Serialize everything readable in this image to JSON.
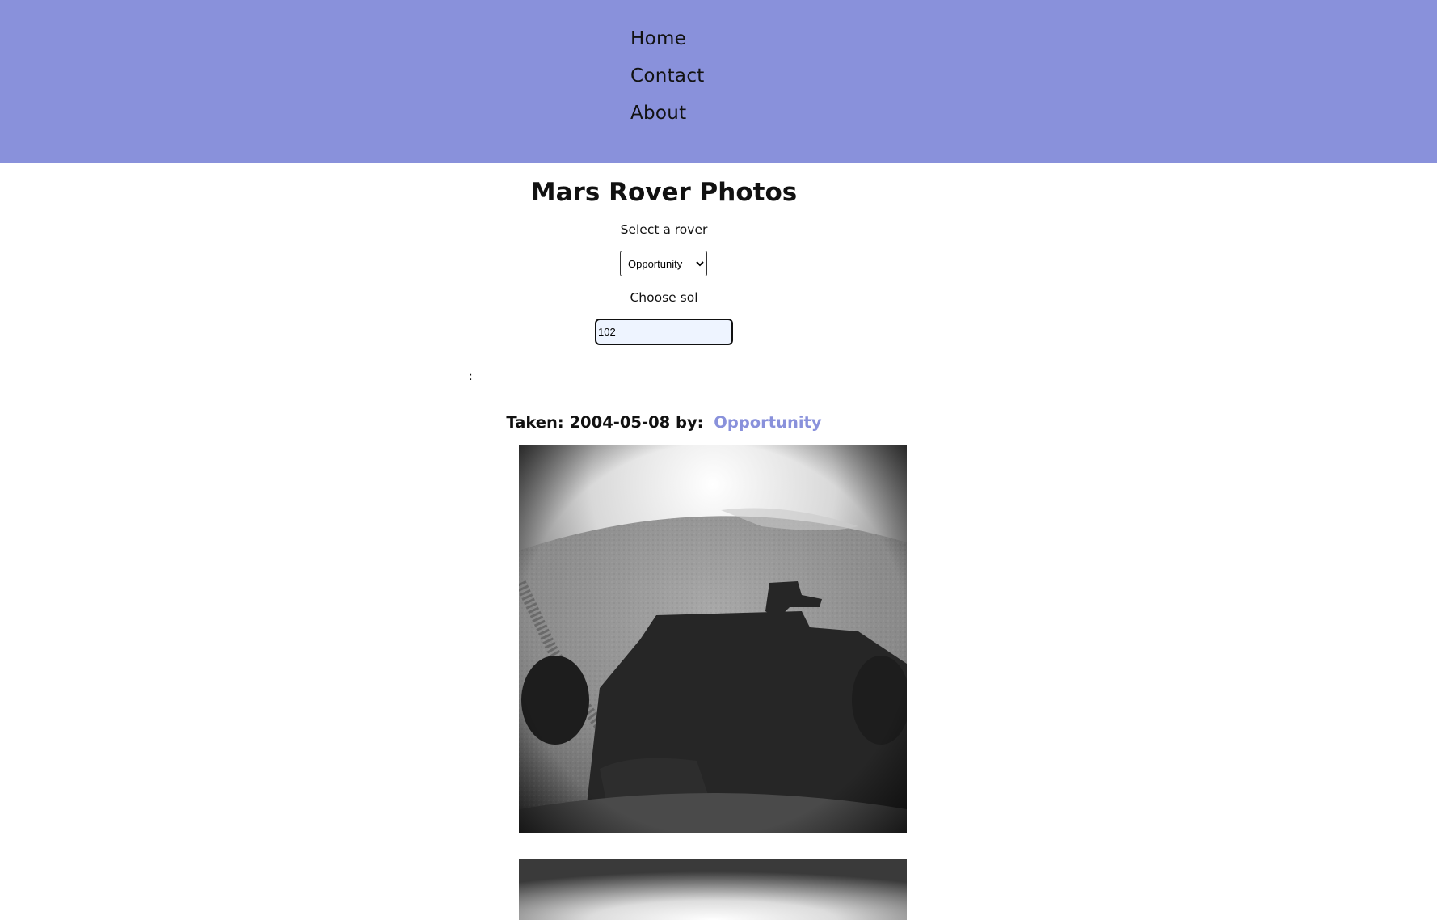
{
  "nav": {
    "items": [
      {
        "label": "Home"
      },
      {
        "label": "Contact"
      },
      {
        "label": "About"
      }
    ]
  },
  "main": {
    "title": "Mars Rover Photos",
    "rover_label": "Select a rover",
    "rover_selected": "Opportunity",
    "sol_label": "Choose sol",
    "sol_value": "102",
    "separator": ":"
  },
  "photos": [
    {
      "taken_prefix": "Taken: 2004-05-08 by:",
      "rover": "Opportunity",
      "image": "mars-surface-rover-shadow-photo"
    },
    {
      "image": "mars-surface-photo"
    }
  ],
  "colors": {
    "header_bg": "#8991db",
    "link": "#8991db"
  }
}
